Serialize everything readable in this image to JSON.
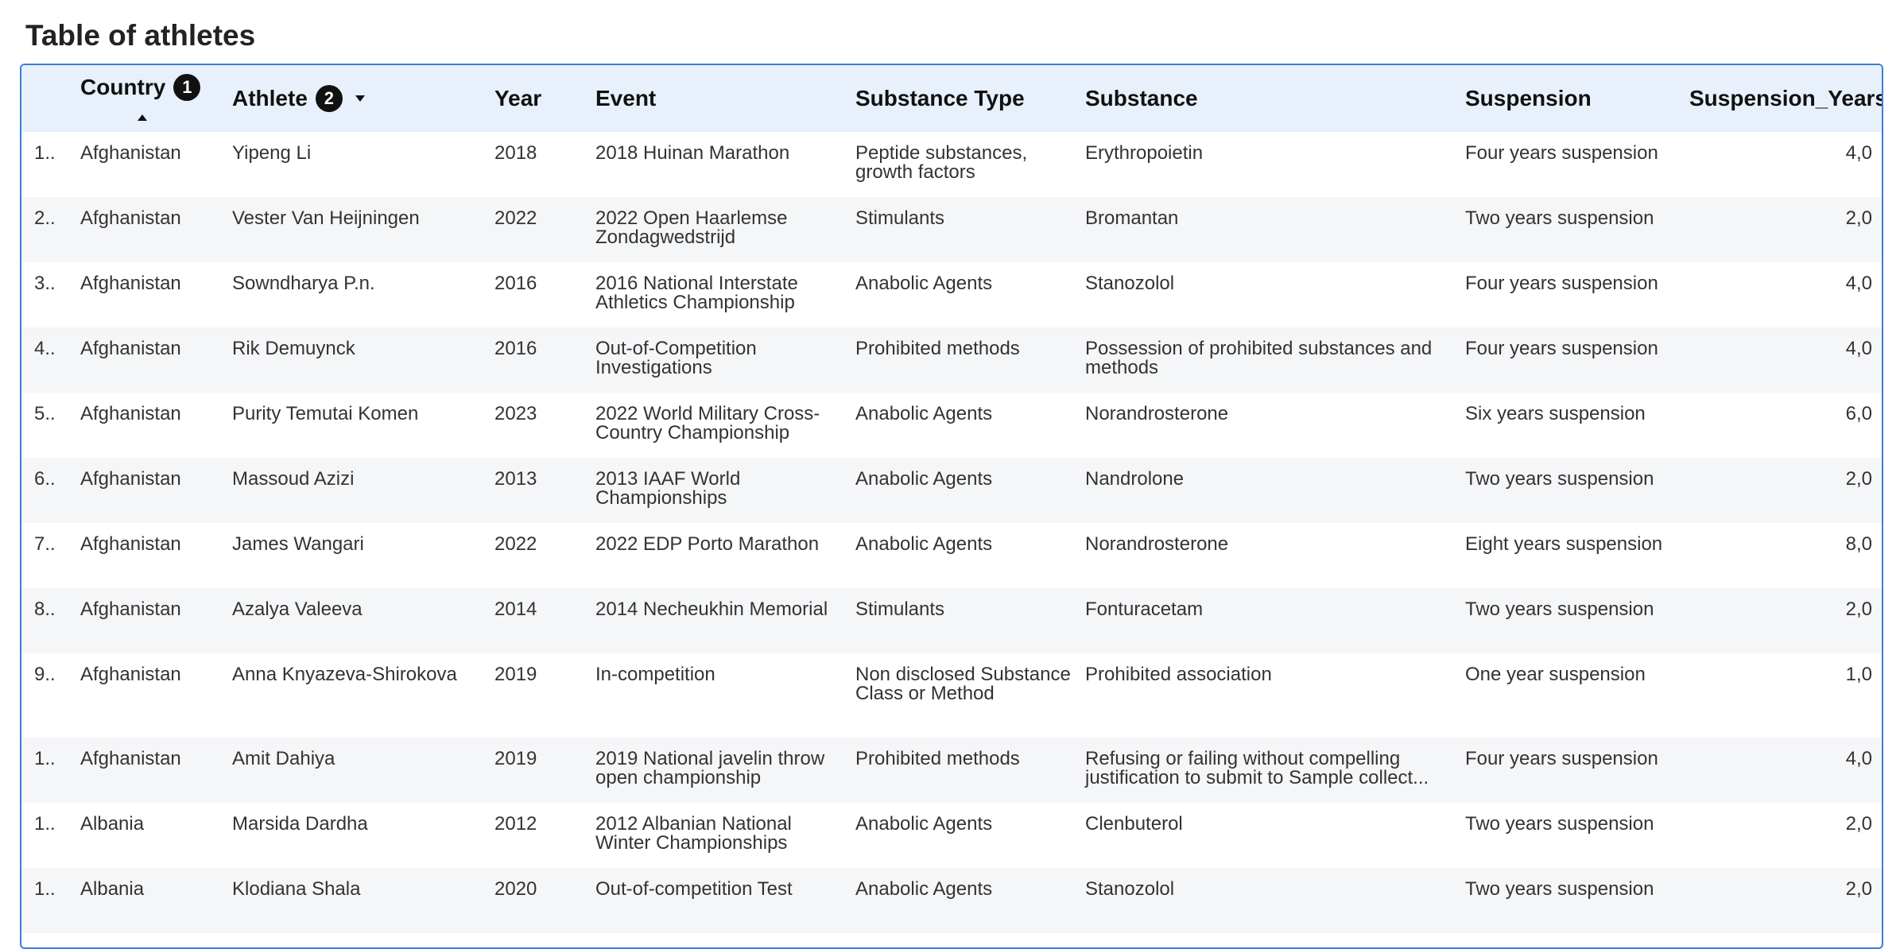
{
  "page": {
    "title": "Table of athletes"
  },
  "table": {
    "columns": [
      {
        "key": "idx",
        "label": ""
      },
      {
        "key": "country",
        "label": "Country",
        "sort_order": "1",
        "sort_dir": "ascending"
      },
      {
        "key": "athlete",
        "label": "Athlete",
        "sort_order": "2"
      },
      {
        "key": "year",
        "label": "Year"
      },
      {
        "key": "event",
        "label": "Event"
      },
      {
        "key": "substance_type",
        "label": "Substance Type"
      },
      {
        "key": "substance",
        "label": "Substance"
      },
      {
        "key": "suspension",
        "label": "Suspension"
      },
      {
        "key": "suspension_years",
        "label": "Suspension_Years"
      }
    ],
    "rows": [
      {
        "idx": "1..",
        "country": "Afghanistan",
        "athlete": "Yipeng Li",
        "year": "2018",
        "event": "2018 Huinan Marathon",
        "substance_type": "Peptide substances, growth factors",
        "substance": "Erythropoietin",
        "suspension": "Four years suspension",
        "suspension_years": "4,0"
      },
      {
        "idx": "2..",
        "country": "Afghanistan",
        "athlete": "Vester Van Heijningen",
        "year": "2022",
        "event": "2022 Open Haarlemse Zondagwedstrijd",
        "substance_type": "Stimulants",
        "substance": "Bromantan",
        "suspension": "Two years suspension",
        "suspension_years": "2,0"
      },
      {
        "idx": "3..",
        "country": "Afghanistan",
        "athlete": "Sowndharya P.n.",
        "year": "2016",
        "event": "2016 National Interstate Athletics Championship",
        "substance_type": "Anabolic Agents",
        "substance": "Stanozolol",
        "suspension": "Four years suspension",
        "suspension_years": "4,0"
      },
      {
        "idx": "4..",
        "country": "Afghanistan",
        "athlete": "Rik Demuynck",
        "year": "2016",
        "event": "Out-of-Competition Investigations",
        "substance_type": "Prohibited methods",
        "substance": "Possession of prohibited substances and methods",
        "suspension": "Four years suspension",
        "suspension_years": "4,0"
      },
      {
        "idx": "5..",
        "country": "Afghanistan",
        "athlete": "Purity Temutai Komen",
        "year": "2023",
        "event": "2022 World Military Cross-Country Championship",
        "substance_type": "Anabolic Agents",
        "substance": "Norandrosterone",
        "suspension": "Six years suspension",
        "suspension_years": "6,0"
      },
      {
        "idx": "6..",
        "country": "Afghanistan",
        "athlete": "Massoud Azizi",
        "year": "2013",
        "event": "2013 IAAF World Championships",
        "substance_type": "Anabolic Agents",
        "substance": "Nandrolone",
        "suspension": "Two years suspension",
        "suspension_years": "2,0"
      },
      {
        "idx": "7..",
        "country": "Afghanistan",
        "athlete": "James Wangari",
        "year": "2022",
        "event": "2022 EDP Porto Marathon",
        "substance_type": "Anabolic Agents",
        "substance": "Norandrosterone",
        "suspension": "Eight years suspension",
        "suspension_years": "8,0"
      },
      {
        "idx": "8..",
        "country": "Afghanistan",
        "athlete": "Azalya Valeeva",
        "year": "2014",
        "event": "2014 Necheukhin Memorial",
        "substance_type": "Stimulants",
        "substance": "Fonturacetam",
        "suspension": "Two years suspension",
        "suspension_years": "2,0"
      },
      {
        "idx": "9..",
        "country": "Afghanistan",
        "athlete": "Anna Knyazeva-Shirokova",
        "year": "2019",
        "event": "In-competition",
        "substance_type": "Non disclosed Substance Class or Method",
        "substance": "Prohibited association",
        "suspension": "One year suspension",
        "suspension_years": "1,0"
      },
      {
        "idx": "1..",
        "country": "Afghanistan",
        "athlete": "Amit Dahiya",
        "year": "2019",
        "event": "2019 National javelin throw open championship",
        "substance_type": "Prohibited methods",
        "substance": "Refusing or failing without compelling justification to submit to Sample collect...",
        "suspension": "Four years suspension",
        "suspension_years": "4,0"
      },
      {
        "idx": "1..",
        "country": "Albania",
        "athlete": "Marsida Dardha",
        "year": "2012",
        "event": "2012 Albanian National Winter Championships",
        "substance_type": "Anabolic Agents",
        "substance": "Clenbuterol",
        "suspension": "Two years suspension",
        "suspension_years": "2,0"
      },
      {
        "idx": "1..",
        "country": "Albania",
        "athlete": "Klodiana Shala",
        "year": "2020",
        "event": "Out-of-competition Test",
        "substance_type": "Anabolic Agents",
        "substance": "Stanozolol",
        "suspension": "Two years suspension",
        "suspension_years": "2,0"
      }
    ]
  }
}
